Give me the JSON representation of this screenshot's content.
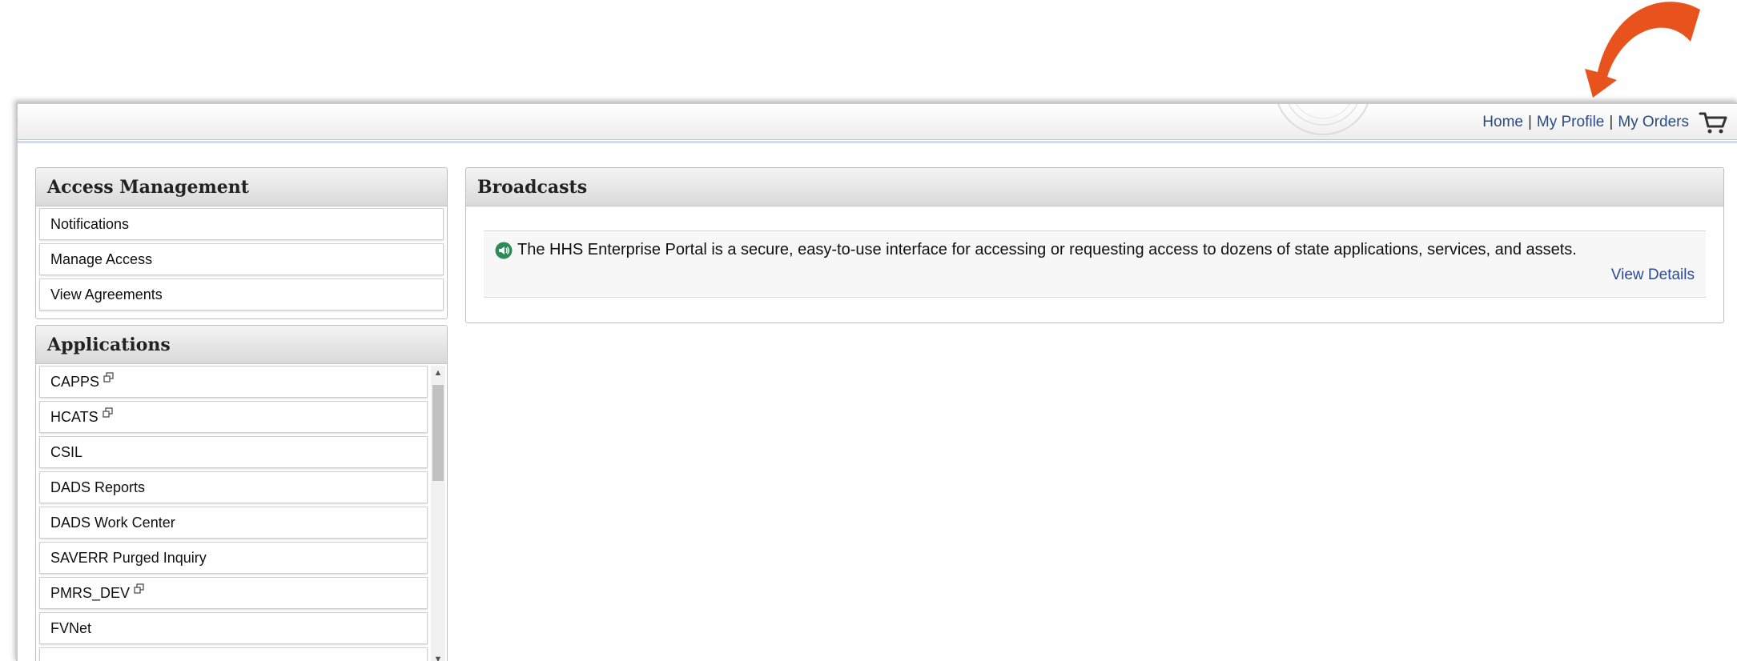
{
  "topnav": {
    "home": "Home",
    "separator": "|",
    "my_profile": "My Profile",
    "my_orders": "My Orders",
    "cart_icon": "shopping-cart-icon"
  },
  "access_management": {
    "title": "Access Management",
    "items": [
      {
        "label": "Notifications"
      },
      {
        "label": "Manage Access"
      },
      {
        "label": "View Agreements"
      }
    ]
  },
  "applications": {
    "title": "Applications",
    "items": [
      {
        "label": "CAPPS",
        "external": true
      },
      {
        "label": "HCATS",
        "external": true
      },
      {
        "label": "CSIL",
        "external": false
      },
      {
        "label": "DADS Reports",
        "external": false
      },
      {
        "label": "DADS Work Center",
        "external": false
      },
      {
        "label": "SAVERR Purged Inquiry",
        "external": false
      },
      {
        "label": "PMRS_DEV",
        "external": true
      },
      {
        "label": "FVNet",
        "external": false
      }
    ]
  },
  "broadcasts": {
    "title": "Broadcasts",
    "message": "The HHS Enterprise Portal is a secure, easy-to-use interface for accessing or requesting access to dozens of state applications, services, and assets.",
    "view_details": "View Details",
    "icon": "speaker-icon"
  },
  "colors": {
    "annotation_arrow": "#e8521d",
    "link": "#2a4a80",
    "broadcast_icon": "#2e8b57"
  }
}
